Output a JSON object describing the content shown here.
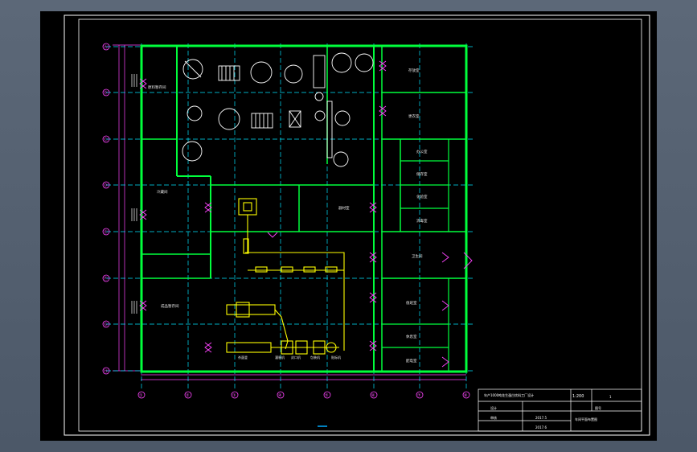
{
  "viewport": {
    "background": "#000000"
  },
  "colors": {
    "wall": "#00ff3c",
    "grid": "#00e5ff",
    "equipment": "#ffffff",
    "pipe": "#ffff00",
    "door": "#ff44ff",
    "dimension": "#ff44ff",
    "border": "#ffffff"
  },
  "grid_axes": {
    "rows": [
      "Ⓐ",
      "Ⓑ",
      "Ⓒ",
      "Ⓓ",
      "Ⓔ",
      "Ⓕ",
      "Ⓖ",
      "Ⓗ"
    ],
    "cols": [
      "①",
      "②",
      "③",
      "④",
      "⑤",
      "⑥",
      "⑦",
      "⑧"
    ]
  },
  "rooms": {
    "r1": "原料暂存间",
    "r2": "冷藏间",
    "r3": "成品暂存间",
    "r4": "存放室",
    "r5": "更衣室",
    "r6": "办公室",
    "r7": "储存室",
    "r8": "化验室",
    "r9": "消毒室",
    "r10": "卫生间",
    "r11": "值班室",
    "r12": "休息室",
    "r13": "配电室",
    "r14": "器材室"
  },
  "equipment": {
    "e1": "杀菌釜",
    "e2": "灌装机",
    "e3": "封口机",
    "e4": "包装机",
    "e5": "贴标机"
  },
  "title_block": {
    "scale": "1:200",
    "project": "年产1000吨花生蛋白饮料工厂设计",
    "drawing_title": "车间平面布置图",
    "designer_label": "设计",
    "checker_label": "审核",
    "date_1": "2017.5",
    "date_2": "2017.6",
    "sheet": "1",
    "sheet_label": "图号"
  }
}
